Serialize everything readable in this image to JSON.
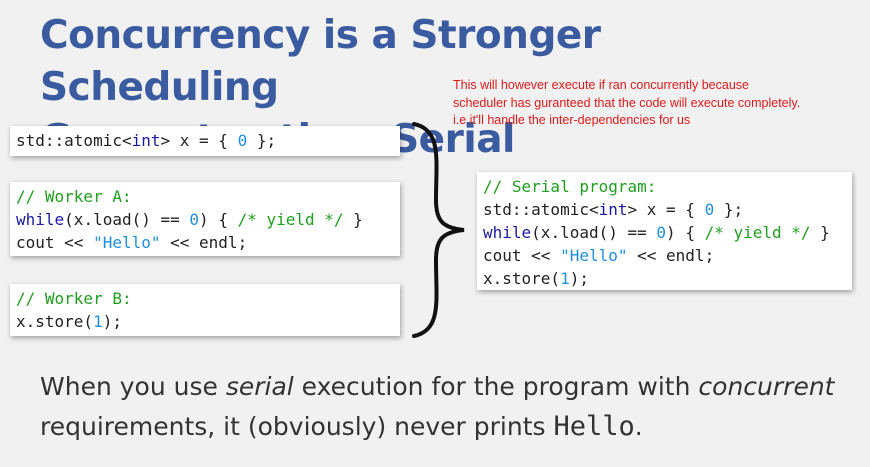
{
  "title": {
    "line1": "Concurrency is a Stronger Scheduling",
    "line2": "Guarantee than Serial"
  },
  "note": {
    "line1": "This will however execute if ran concurrently because",
    "line2": "scheduler has guranteed that the code will execute completely.",
    "line3": "i.e it'll handle the inter-dependencies for us"
  },
  "code_atomic": {
    "p1": "std::atomic<",
    "type": "int",
    "p2": "> x = { ",
    "num": "0",
    "p3": " };"
  },
  "code_worker_a": {
    "comment": "// Worker A:",
    "while_kw": "while",
    "while_p1": "(x.load() == ",
    "while_num": "0",
    "while_p2": ") { ",
    "yield_comment": "/* yield */",
    "while_p3": " }",
    "cout_p1": "cout << ",
    "cout_str": "\"Hello\"",
    "cout_p2": " << endl;"
  },
  "code_worker_b": {
    "comment": "// Worker B:",
    "store_p1": "x.store(",
    "store_num": "1",
    "store_p2": ");"
  },
  "code_serial": {
    "comment": "// Serial program:",
    "atomic_p1": "std::atomic<",
    "atomic_type": "int",
    "atomic_p2": "> x = { ",
    "atomic_num": "0",
    "atomic_p3": " };",
    "while_kw": "while",
    "while_p1": "(x.load() == ",
    "while_num": "0",
    "while_p2": ") { ",
    "yield_comment": "/* yield */",
    "while_p3": " }",
    "cout_p1": "cout << ",
    "cout_str": "\"Hello\"",
    "cout_p2": " << endl;",
    "store_p1": "x.store(",
    "store_num": "1",
    "store_p2": ");"
  },
  "bottom": {
    "l1_a": "When you use ",
    "l1_em1": "serial",
    "l1_b": " execution for the program with ",
    "l1_em2": "concurrent",
    "l2_a": "requirements, it (obviously) never prints ",
    "l2_code": "Hello",
    "l2_b": "."
  }
}
